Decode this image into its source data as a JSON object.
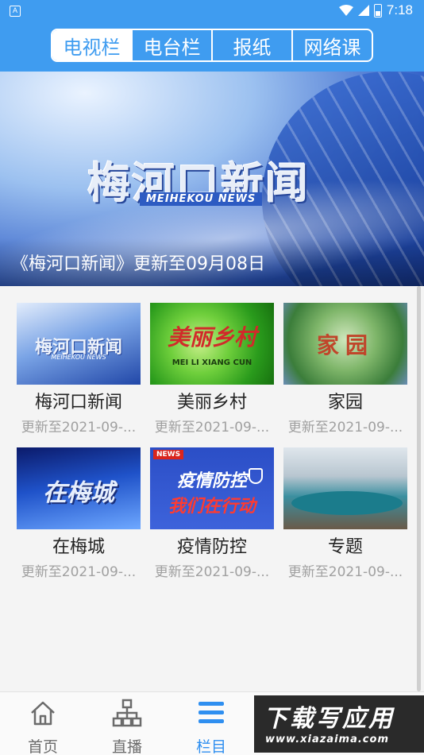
{
  "status_bar": {
    "carrier_icon_text": "A",
    "time": "7:18"
  },
  "tabs": [
    {
      "label": "电视栏",
      "active": true
    },
    {
      "label": "电台栏",
      "active": false
    },
    {
      "label": "报纸",
      "active": false
    },
    {
      "label": "网络课",
      "active": false
    }
  ],
  "banner": {
    "logo_text": "梅河口新闻",
    "logo_subtext": "MEIHEKOU NEWS",
    "caption": "《梅河口新闻》更新至09月08日"
  },
  "programs": [
    {
      "name": "梅河口新闻",
      "updated": "更新至2021-09-...",
      "thumb_text": "梅河口新闻",
      "thumb_subtext": "MEIHEKOU NEWS"
    },
    {
      "name": "美丽乡村",
      "updated": "更新至2021-09-...",
      "thumb_text": "美丽乡村",
      "thumb_subtext": "MEI LI XIANG CUN"
    },
    {
      "name": "家园",
      "updated": "更新至2021-09-...",
      "thumb_text": "家园"
    },
    {
      "name": "在梅城",
      "updated": "更新至2021-09-...",
      "thumb_text": "在梅城"
    },
    {
      "name": "疫情防控",
      "updated": "更新至2021-09-...",
      "thumb_badge": "NEWS",
      "thumb_line1": "疫情防控",
      "thumb_line2": "我们在行动"
    },
    {
      "name": "专题",
      "updated": "更新至2021-09-..."
    }
  ],
  "bottom_nav": [
    {
      "label": "首页",
      "icon": "home-icon",
      "active": false
    },
    {
      "label": "直播",
      "icon": "sitemap-icon",
      "active": false
    },
    {
      "label": "栏目",
      "icon": "menu-icon",
      "active": true
    }
  ],
  "watermark": {
    "text": "下载写应用",
    "url": "www.xiazaima.com"
  },
  "colors": {
    "primary": "#3f9cf0",
    "active_nav": "#2f8ff0",
    "muted": "#a0a0a0"
  }
}
